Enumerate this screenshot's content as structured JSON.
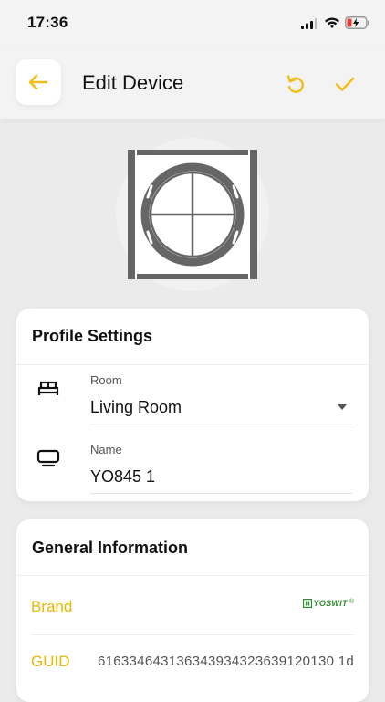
{
  "status": {
    "time": "17:36"
  },
  "header": {
    "title": "Edit Device",
    "accent": "#f2bd1c"
  },
  "profile": {
    "title": "Profile Settings",
    "room_label": "Room",
    "room_value": "Living Room",
    "name_label": "Name",
    "name_value": "YO845 1"
  },
  "general": {
    "title": "General Information",
    "brand_label": "Brand",
    "brand_logo_text": "YOSWIT",
    "brand_logo_mark": "®",
    "guid_label": "GUID",
    "guid_value": "616334643136343934323639120130 1d"
  },
  "icons": {
    "back": "arrow-left-icon",
    "undo": "undo-icon",
    "save": "check-icon",
    "room": "bed-icon",
    "name": "tv-icon",
    "dropdown": "caret-down-icon"
  }
}
